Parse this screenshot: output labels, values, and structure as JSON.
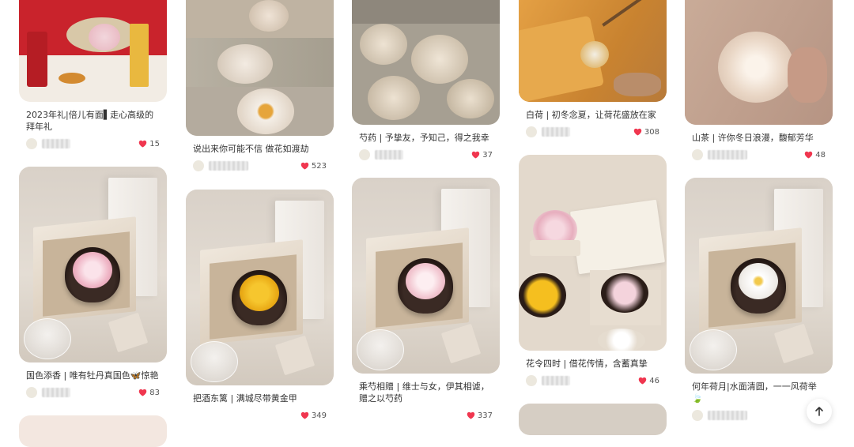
{
  "feed": {
    "col1": [
      {
        "title": "2023年礼|倍儿有面▌走心高级的拜年礼",
        "likes": "15"
      },
      {
        "title": "国色添香 | 唯有牡丹真国色🦋惊艳",
        "likes": "83"
      },
      {
        "title": "",
        "likes": ""
      }
    ],
    "col2": [
      {
        "title": "说出来你可能不信 做花如渡劫",
        "likes": "523"
      },
      {
        "title": "把酒东篱 | 满城尽带黄金甲",
        "likes": "349"
      }
    ],
    "col3": [
      {
        "title": "芍药 | 予挚友，予知己，得之我幸",
        "likes": "37"
      },
      {
        "title": "乘芍相赠 | 维士与女，伊其相谑，赠之以芍药",
        "likes": "337"
      }
    ],
    "col4": [
      {
        "title": "白荷 | 初冬念夏，让荷花盛放在家",
        "likes": "308"
      },
      {
        "title": "花令四时 | 借花传情，含蓄真挚",
        "likes": "46"
      },
      {
        "title": "",
        "likes": ""
      }
    ],
    "col5": [
      {
        "title": "山茶 | 许你冬日浪漫，馥郁芳华",
        "likes": "48"
      },
      {
        "title": "何年荷月|水面清圆，一一风荷举🍃",
        "likes": ""
      }
    ]
  },
  "icons": {
    "like": "heart-icon",
    "scroll_top": "arrow-up-icon"
  },
  "colors": {
    "heart": "#f0364f",
    "background": "#ffffff"
  }
}
